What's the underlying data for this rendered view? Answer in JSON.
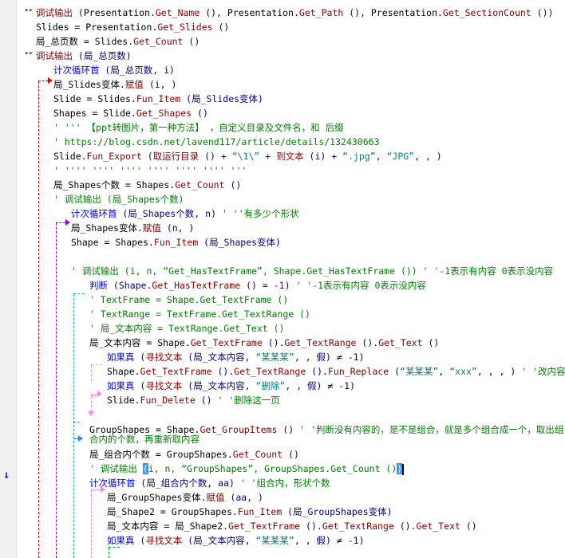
{
  "editor": {
    "gutter": {
      "current_line_icon": "down-arrow-icon"
    },
    "lines": [
      {
        "segments": [
          {
            "c": "k",
            "t": "调试输出"
          },
          {
            "c": "p",
            "t": " ("
          },
          {
            "c": "t",
            "t": "Presentation."
          },
          {
            "c": "k",
            "t": "Get_Name"
          },
          {
            "c": "p",
            "t": " (), "
          },
          {
            "c": "t",
            "t": "Presentation."
          },
          {
            "c": "k",
            "t": "Get_Path"
          },
          {
            "c": "p",
            "t": " (), "
          },
          {
            "c": "t",
            "t": "Presentation."
          },
          {
            "c": "k",
            "t": "Get_SectionCount"
          },
          {
            "c": "p",
            "t": " ())"
          }
        ]
      },
      {
        "segments": [
          {
            "c": "t",
            "t": "Slides = Presentation."
          },
          {
            "c": "k",
            "t": "Get_Slides"
          },
          {
            "c": "p",
            "t": " ()"
          }
        ]
      },
      {
        "segments": [
          {
            "c": "t",
            "t": "局_总页数 = Slides."
          },
          {
            "c": "k",
            "t": "Get_Count"
          },
          {
            "c": "p",
            "t": " ()"
          }
        ]
      },
      {
        "segments": [
          {
            "c": "k",
            "t": "调试输出"
          },
          {
            "c": "p",
            "t": " (局_总页数)"
          }
        ]
      },
      {
        "segments": [
          {
            "c": "b",
            "t": "计次循环首"
          },
          {
            "c": "p",
            "t": " (局_总页数, i)"
          }
        ]
      },
      {
        "segments": [
          {
            "c": "t",
            "t": "局_Slides变体."
          },
          {
            "c": "k",
            "t": "赋值"
          },
          {
            "c": "p",
            "t": " (i, )"
          }
        ]
      },
      {
        "segments": [
          {
            "c": "t",
            "t": "Slide = Slides."
          },
          {
            "c": "k",
            "t": "Fun_Item"
          },
          {
            "c": "p",
            "t": " (局_Slides变体)"
          }
        ]
      },
      {
        "segments": [
          {
            "c": "t",
            "t": "Shapes = Slide."
          },
          {
            "c": "k",
            "t": "Get_Shapes"
          },
          {
            "c": "p",
            "t": " ()"
          }
        ]
      },
      {
        "segments": [
          {
            "c": "c",
            "t": "' ''' 【ppt转图片，第一种方法】 ，自定义目录及文件名，和 后缀"
          }
        ]
      },
      {
        "segments": [
          {
            "c": "c",
            "t": "' https://blog.csdn.net/lavend117/article/details/132430663"
          }
        ]
      },
      {
        "segments": [
          {
            "c": "t",
            "t": "Slide."
          },
          {
            "c": "k",
            "t": "Fun_Export"
          },
          {
            "c": "p",
            "t": " ("
          },
          {
            "c": "k",
            "t": "取运行目录"
          },
          {
            "c": "p",
            "t": " () + "
          },
          {
            "c": "s",
            "t": "“\\1\\”"
          },
          {
            "c": "p",
            "t": " + "
          },
          {
            "c": "k",
            "t": "到文本"
          },
          {
            "c": "p",
            "t": " (i) + "
          },
          {
            "c": "s",
            "t": "“.jpg”"
          },
          {
            "c": "p",
            "t": ", "
          },
          {
            "c": "s",
            "t": "“JPG”"
          },
          {
            "c": "p",
            "t": ", , )"
          }
        ]
      },
      {
        "segments": [
          {
            "c": "c",
            "t": "' '''' '''' '''' '''' '''' '''' '''"
          }
        ]
      },
      {
        "segments": []
      },
      {
        "segments": [
          {
            "c": "t",
            "t": "局_Shapes个数 = Shapes."
          },
          {
            "c": "k",
            "t": "Get_Count"
          },
          {
            "c": "p",
            "t": " ()"
          }
        ]
      },
      {
        "segments": [
          {
            "c": "c",
            "t": "' 调试输出 (局_Shapes个数)"
          }
        ]
      },
      {
        "segments": [
          {
            "c": "b",
            "t": "计次循环首"
          },
          {
            "c": "p",
            "t": " (局_Shapes个数, n) "
          },
          {
            "c": "c",
            "t": "' ''有多少个形状"
          }
        ]
      },
      {
        "segments": [
          {
            "c": "t",
            "t": "局_Shapes变体."
          },
          {
            "c": "k",
            "t": "赋值"
          },
          {
            "c": "p",
            "t": " (n, )"
          }
        ]
      },
      {
        "segments": [
          {
            "c": "t",
            "t": "Shape = Shapes."
          },
          {
            "c": "k",
            "t": "Fun_Item"
          },
          {
            "c": "p",
            "t": " (局_Shapes变体)"
          }
        ]
      },
      {
        "segments": []
      },
      {
        "segments": [
          {
            "c": "c",
            "t": "' 调试输出 (i, n, “Get_HasTextFrame”, Shape.Get_HasTextFrame ()) ' '-1表示有内容 0表示没内容"
          }
        ]
      },
      {
        "segments": [
          {
            "c": "b",
            "t": "判断"
          },
          {
            "c": "p",
            "t": " (Shape."
          },
          {
            "c": "k",
            "t": "Get_HasTextFrame"
          },
          {
            "c": "p",
            "t": " () = "
          },
          {
            "c": "k",
            "t": "-1"
          },
          {
            "c": "p",
            "t": ") "
          },
          {
            "c": "c",
            "t": "' '-1表示有内容 0表示没内容"
          }
        ]
      },
      {
        "segments": [
          {
            "c": "c",
            "t": "' TextFrame = Shape.Get_TextFrame ()"
          }
        ]
      },
      {
        "segments": [
          {
            "c": "c",
            "t": "' TextRange = TextFrame.Get_TextRange ()"
          }
        ]
      },
      {
        "segments": [
          {
            "c": "c",
            "t": "' 局_文本内容 = TextRange.Get_Text ()"
          }
        ]
      },
      {
        "segments": [
          {
            "c": "t",
            "t": "局_文本内容 = Shape."
          },
          {
            "c": "k",
            "t": "Get_TextFrame"
          },
          {
            "c": "p",
            "t": " ()."
          },
          {
            "c": "k",
            "t": "Get_TextRange"
          },
          {
            "c": "p",
            "t": " ()."
          },
          {
            "c": "k",
            "t": "Get_Text"
          },
          {
            "c": "p",
            "t": " ()"
          }
        ]
      },
      {
        "segments": [
          {
            "c": "b",
            "t": "如果真"
          },
          {
            "c": "p",
            "t": " ("
          },
          {
            "c": "k",
            "t": "寻找文本"
          },
          {
            "c": "p",
            "t": " (局_文本内容, "
          },
          {
            "c": "s",
            "t": "“某某某”"
          },
          {
            "c": "p",
            "t": ", , 假) ≠ -1)"
          }
        ]
      },
      {
        "segments": [
          {
            "c": "t",
            "t": "Shape."
          },
          {
            "c": "k",
            "t": "Get_TextFrame"
          },
          {
            "c": "p",
            "t": " ()."
          },
          {
            "c": "k",
            "t": "Get_TextRange"
          },
          {
            "c": "p",
            "t": " ()."
          },
          {
            "c": "k",
            "t": "Fun_Replace"
          },
          {
            "c": "p",
            "t": " ("
          },
          {
            "c": "s",
            "t": "“某某某”"
          },
          {
            "c": "p",
            "t": ", "
          },
          {
            "c": "s",
            "t": "“xxx”"
          },
          {
            "c": "p",
            "t": ", , , ) "
          },
          {
            "c": "c",
            "t": "' '改内容"
          }
        ]
      },
      {
        "segments": [
          {
            "c": "b",
            "t": "如果真"
          },
          {
            "c": "p",
            "t": " ("
          },
          {
            "c": "k",
            "t": "寻找文本"
          },
          {
            "c": "p",
            "t": " (局_文本内容, "
          },
          {
            "c": "s",
            "t": "“删除”"
          },
          {
            "c": "p",
            "t": ", , 假) ≠ -1)"
          }
        ]
      },
      {
        "segments": [
          {
            "c": "t",
            "t": "Slide."
          },
          {
            "c": "k",
            "t": "Fun_Delete"
          },
          {
            "c": "p",
            "t": " () "
          },
          {
            "c": "c",
            "t": "' '删除这一页"
          }
        ]
      },
      {
        "segments": []
      },
      {
        "segments": [
          {
            "c": "t",
            "t": "GroupShapes = Shape."
          },
          {
            "c": "k",
            "t": "Get_GroupItems"
          },
          {
            "c": "p",
            "t": " () "
          },
          {
            "c": "c",
            "t": "' '判断没有内容的，是不是组合，就是多个组合成一个，取出组"
          }
        ]
      },
      {
        "segments": [
          {
            "c": "c",
            "t": "合内的个数，再重新取内容"
          }
        ]
      },
      {
        "segments": [
          {
            "c": "t",
            "t": "局_组合内个数 = GroupShapes."
          },
          {
            "c": "k",
            "t": "Get_Count"
          },
          {
            "c": "p",
            "t": " ()"
          }
        ]
      },
      {
        "segments": [
          {
            "c": "c",
            "t": "' 调试输出 "
          },
          {
            "c": "sel",
            "t": "("
          },
          {
            "c": "c",
            "t": "i, n, “GroupShapes”, GroupShapes.Get_Count ()"
          },
          {
            "c": "sel",
            "t": ")"
          },
          {
            "c": "caret",
            "t": ""
          }
        ]
      },
      {
        "segments": [
          {
            "c": "b",
            "t": "计次循环首"
          },
          {
            "c": "p",
            "t": " (局_组合内个数, aa) "
          },
          {
            "c": "c",
            "t": "' '组合内，形状个数"
          }
        ]
      },
      {
        "segments": [
          {
            "c": "t",
            "t": "局_GroupShapes变体."
          },
          {
            "c": "k",
            "t": "赋值"
          },
          {
            "c": "p",
            "t": " (aa, )"
          }
        ]
      },
      {
        "segments": [
          {
            "c": "t",
            "t": "局_Shape2 = GroupShapes."
          },
          {
            "c": "k",
            "t": "Fun_Item"
          },
          {
            "c": "p",
            "t": " (局_GroupShapes变体)"
          }
        ]
      },
      {
        "segments": [
          {
            "c": "t",
            "t": "局_文本内容 = 局_Shape2."
          },
          {
            "c": "k",
            "t": "Get_TextFrame"
          },
          {
            "c": "p",
            "t": " ()."
          },
          {
            "c": "k",
            "t": "Get_TextRange"
          },
          {
            "c": "p",
            "t": " ()."
          },
          {
            "c": "k",
            "t": "Get_Text"
          },
          {
            "c": "p",
            "t": " ()"
          }
        ]
      },
      {
        "segments": [
          {
            "c": "b",
            "t": "如果真"
          },
          {
            "c": "p",
            "t": " ("
          },
          {
            "c": "k",
            "t": "寻找文本"
          },
          {
            "c": "p",
            "t": " (局_文本内容, "
          },
          {
            "c": "s",
            "t": "“某某某”"
          },
          {
            "c": "p",
            "t": ", , 假) ≠ -1)"
          }
        ]
      }
    ]
  }
}
